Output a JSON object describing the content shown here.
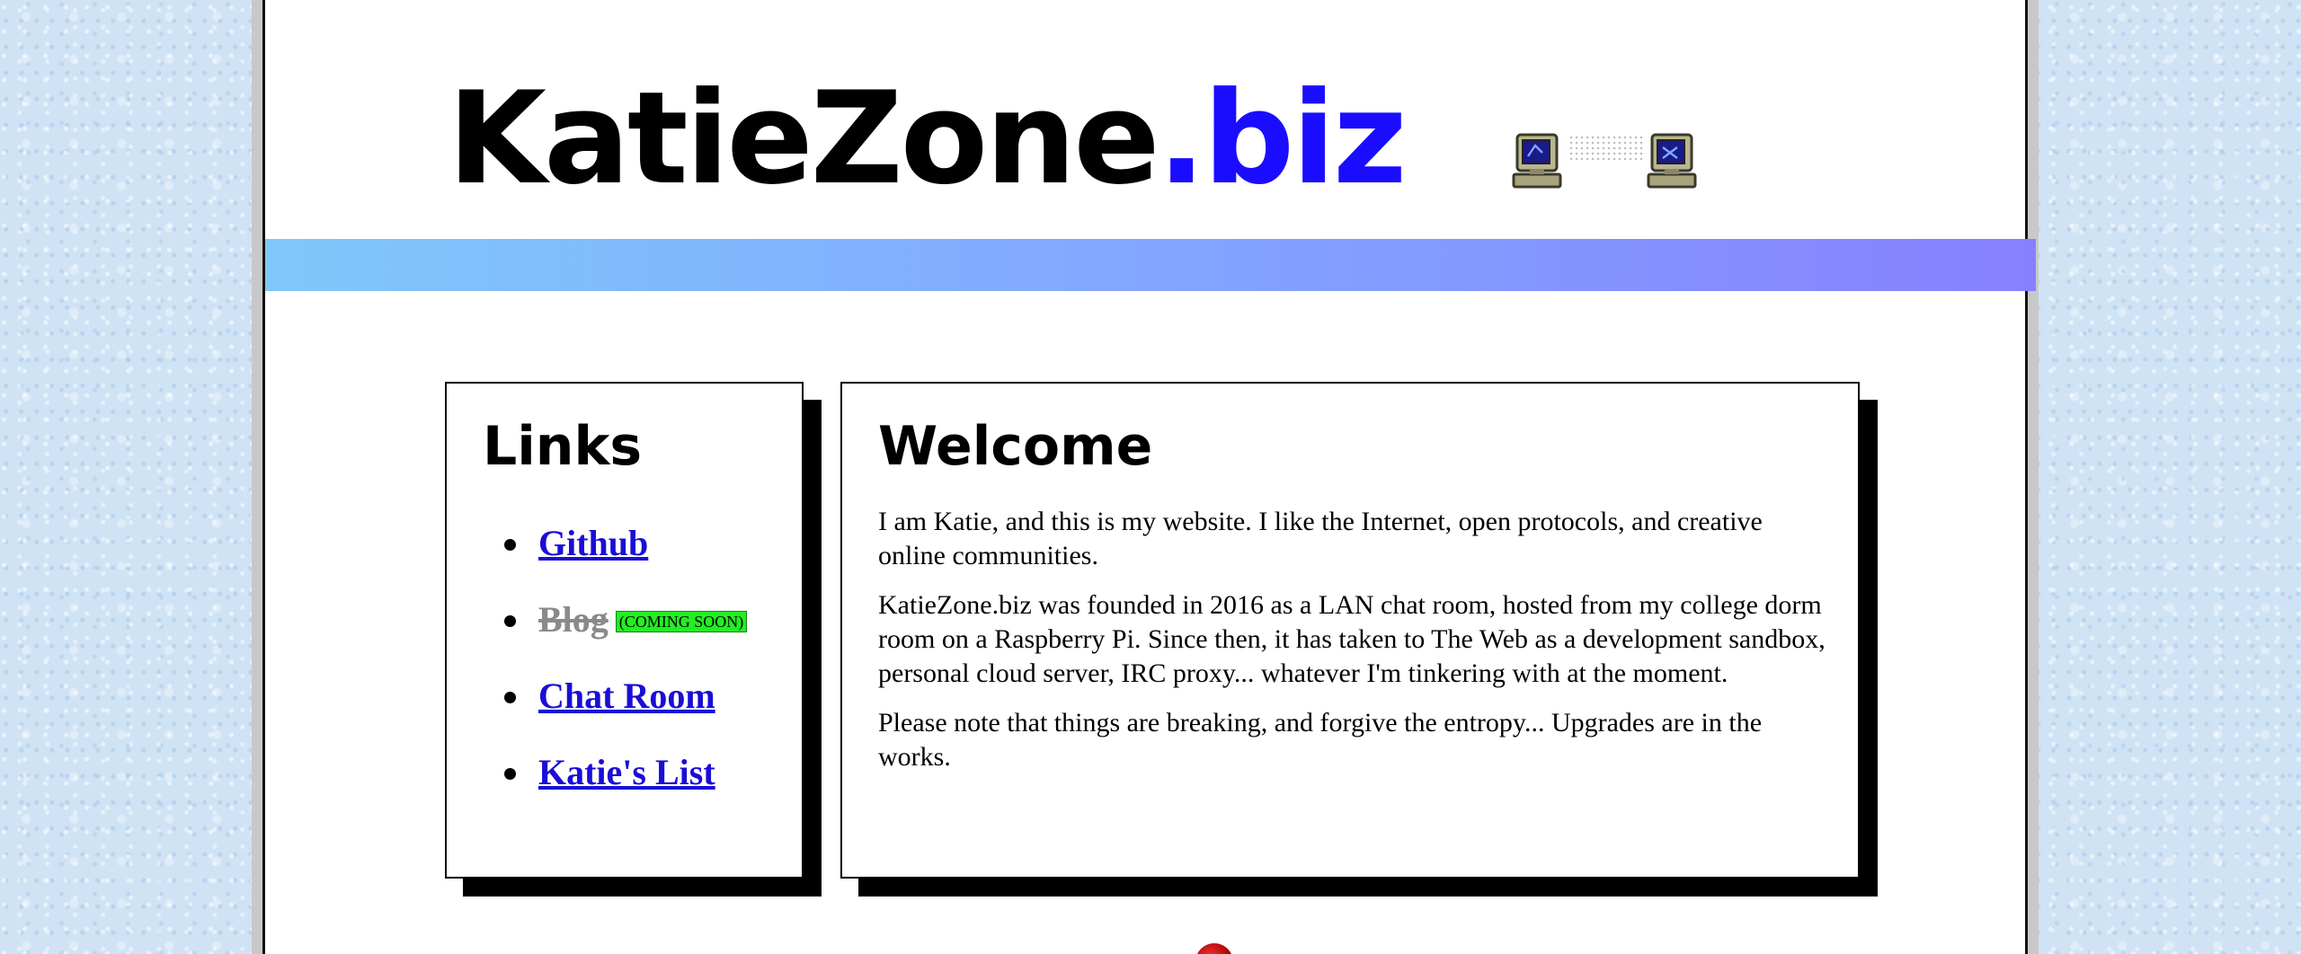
{
  "header": {
    "title_main": "KatieZone",
    "title_tld": ".biz",
    "network_icon": "networked-computers-icon"
  },
  "colors": {
    "tld": "#1a0dff",
    "banner_start": "#80c8fb",
    "banner_end": "#8680ff",
    "link": "#1a0dd6",
    "badge": "#22ee22"
  },
  "links": {
    "heading": "Links",
    "items": [
      {
        "label": "Github"
      },
      {
        "label": "Blog",
        "badge": "(COMING SOON)"
      },
      {
        "label": "Chat Room"
      },
      {
        "label": "Katie's List"
      }
    ]
  },
  "welcome": {
    "heading": "Welcome",
    "paragraphs": [
      "I am Katie, and this is my website. I like the Internet, open protocols, and creative online communities.",
      "KatieZone.biz was founded in 2016 as a LAN chat room, hosted from my college dorm room on a Raspberry Pi. Since then, it has taken to The Web as a development sandbox, personal cloud server, IRC proxy... whatever I'm tinkering with at the moment.",
      "Please note that things are breaking, and forgive the entropy... Upgrades are in the works."
    ]
  }
}
